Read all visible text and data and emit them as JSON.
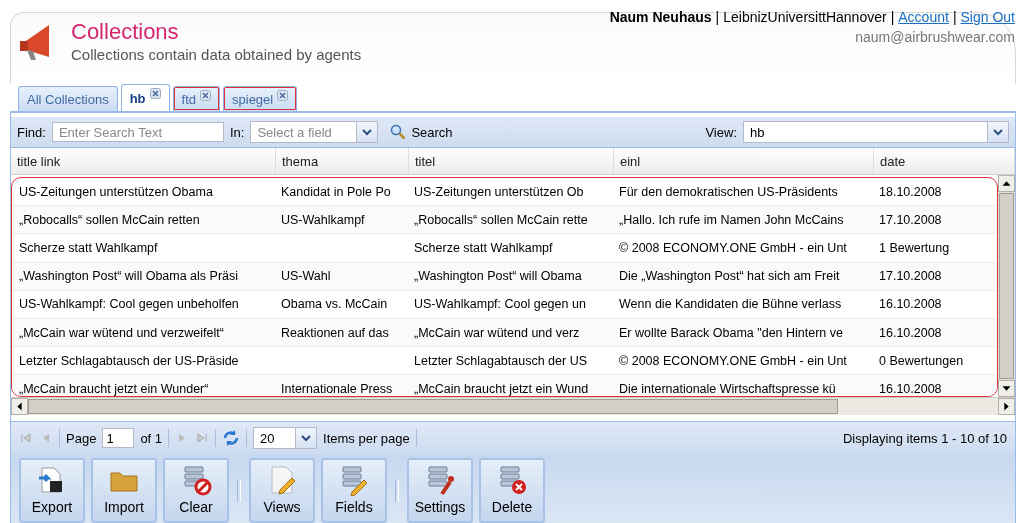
{
  "header": {
    "title": "Collections",
    "subtitle": "Collections contain data obtained by agents",
    "user": "Naum Neuhaus",
    "org": "LeibnizUniversittHannover",
    "separator": "|",
    "links": [
      "Account",
      "Sign Out"
    ],
    "email": "naum@airbrushwear.com"
  },
  "tabs": [
    {
      "label": "All Collections",
      "selected": false,
      "closable": false,
      "highlighted": false
    },
    {
      "label": "hb",
      "selected": true,
      "closable": true,
      "highlighted": false
    },
    {
      "label": "ftd",
      "selected": false,
      "closable": true,
      "highlighted": true
    },
    {
      "label": "spiegel",
      "selected": false,
      "closable": true,
      "highlighted": true
    }
  ],
  "toolbar": {
    "find_label": "Find:",
    "find_placeholder": "Enter Search Text",
    "in_label": "In:",
    "field_placeholder": "Select a field",
    "search_button": "Search",
    "view_label": "View:",
    "view_value": "hb"
  },
  "table": {
    "highlighted": true,
    "columns": [
      "title link",
      "thema",
      "titel",
      "einl",
      "date"
    ],
    "rows": [
      [
        "US-Zeitungen unterstützen Obama",
        "Kandidat in Pole Po",
        "US-Zeitungen unterstützen Ob",
        "Für den demokratischen US-Präsidents",
        "18.10.2008"
      ],
      [
        "„Robocalls“ sollen McCain retten",
        "US-Wahlkampf",
        "„Robocalls“ sollen McCain rette",
        "„Hallo. Ich rufe im Namen John McCains",
        "17.10.2008"
      ],
      [
        "Scherze statt Wahlkampf",
        null,
        "Scherze statt Wahlkampf",
        "© 2008 ECONOMY.ONE GmbH - ein Unt",
        "1 Bewertung"
      ],
      [
        "„Washington Post“ will Obama als Präsi",
        "US-Wahl",
        "„Washington Post“ will Obama",
        "Die „Washington Post“ hat sich am Freit",
        "17.10.2008"
      ],
      [
        "US-Wahlkampf: Cool gegen unbeholfen",
        "Obama vs. McCain",
        "US-Wahlkampf: Cool gegen un",
        "Wenn die Kandidaten die Bühne verlass",
        "16.10.2008"
      ],
      [
        "„McCain war wütend und verzweifelt“",
        "Reaktionen auf das",
        "„McCain war wütend und verz",
        "Er wollte Barack Obama \"den Hintern ve",
        "16.10.2008"
      ],
      [
        "Letzter Schlagabtausch der US-Präside",
        null,
        "Letzter Schlagabtausch der US",
        "© 2008 ECONOMY.ONE GmbH - ein Unt",
        "0 Bewertungen"
      ],
      [
        "„McCain braucht jetzt ein Wunder“",
        "Internationale Press",
        "„McCain braucht jetzt ein Wund",
        "Die internationale Wirtschaftspresse kü",
        "16.10.2008"
      ]
    ]
  },
  "pager": {
    "page_label": "Page",
    "page_value": "1",
    "of_label": "of 1",
    "page_size": "20",
    "per_page_label": "Items per page",
    "status": "Displaying items 1 - 10 of 10"
  },
  "actions": [
    {
      "kind": "export",
      "label": "Export"
    },
    {
      "kind": "import",
      "label": "Import"
    },
    {
      "kind": "clear",
      "label": "Clear"
    },
    {
      "kind": "views",
      "label": "Views",
      "group_start": true
    },
    {
      "kind": "fields",
      "label": "Fields"
    },
    {
      "kind": "settings",
      "label": "Settings",
      "group_start": true
    },
    {
      "kind": "delete",
      "label": "Delete"
    }
  ]
}
